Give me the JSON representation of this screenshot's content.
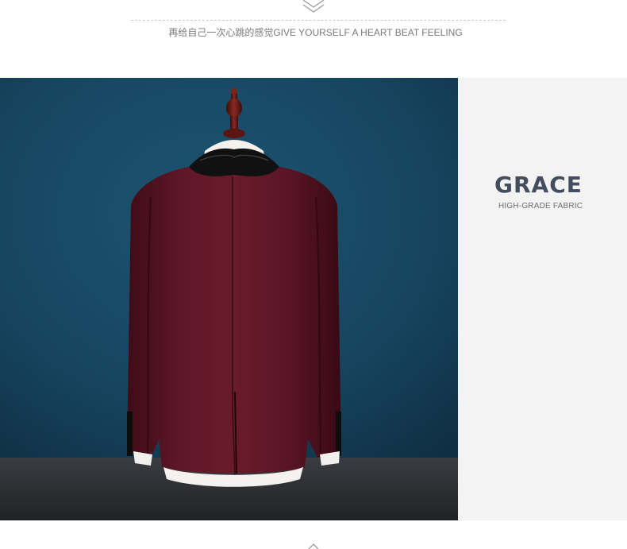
{
  "header": {
    "icon": "double-chevron-down-icon",
    "tagline": "再给自己一次心跳的感觉GIVE YOURSELF A HEART BEAT FEELING"
  },
  "photo": {
    "subject": "burgundy-suit-jacket-back-on-mannequin-icon",
    "background_color": "#17425a",
    "jacket_color": "#5a1522",
    "lapel_color": "#111111"
  },
  "side_panel": {
    "title": "GRACE",
    "subtitle": "HIGH-GRADE FABRIC",
    "background_color": "#f3f3f3",
    "title_color": "#434d5e"
  },
  "footer": {
    "icon": "chevron-up-icon"
  }
}
